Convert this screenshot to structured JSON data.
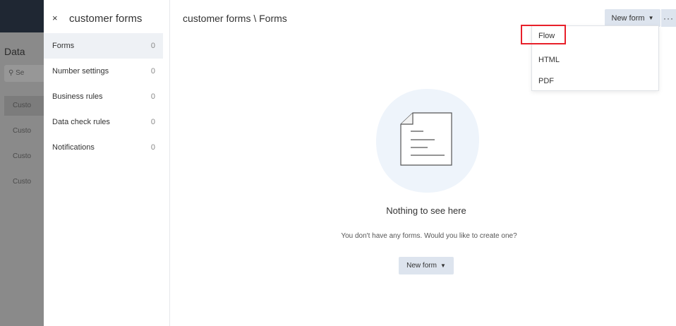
{
  "background_app": {
    "title": "Data",
    "search_placeholder": "Se",
    "items": [
      {
        "label": "Custo"
      },
      {
        "label": "Custo"
      },
      {
        "label": "Custo"
      },
      {
        "label": "Custo"
      }
    ]
  },
  "side_panel": {
    "close_symbol": "×",
    "title": "customer forms",
    "nav": [
      {
        "label": "Forms",
        "count": "0"
      },
      {
        "label": "Number settings",
        "count": "0"
      },
      {
        "label": "Business rules",
        "count": "0"
      },
      {
        "label": "Data check rules",
        "count": "0"
      },
      {
        "label": "Notifications",
        "count": "0"
      }
    ]
  },
  "main": {
    "breadcrumb": "customer forms \\ Forms",
    "new_form_label": "New form",
    "more_label": "···",
    "dropdown": {
      "items": [
        {
          "label": "Flow"
        },
        {
          "label": "HTML"
        },
        {
          "label": "PDF"
        }
      ]
    },
    "empty_state": {
      "title": "Nothing to see here",
      "subtitle": "You don't have any forms. Would you like to create one?",
      "button_label": "New form"
    }
  },
  "colors": {
    "highlight": "#e8202a",
    "button_bg": "#dde4ee",
    "overlay": "#8a8a8a"
  }
}
